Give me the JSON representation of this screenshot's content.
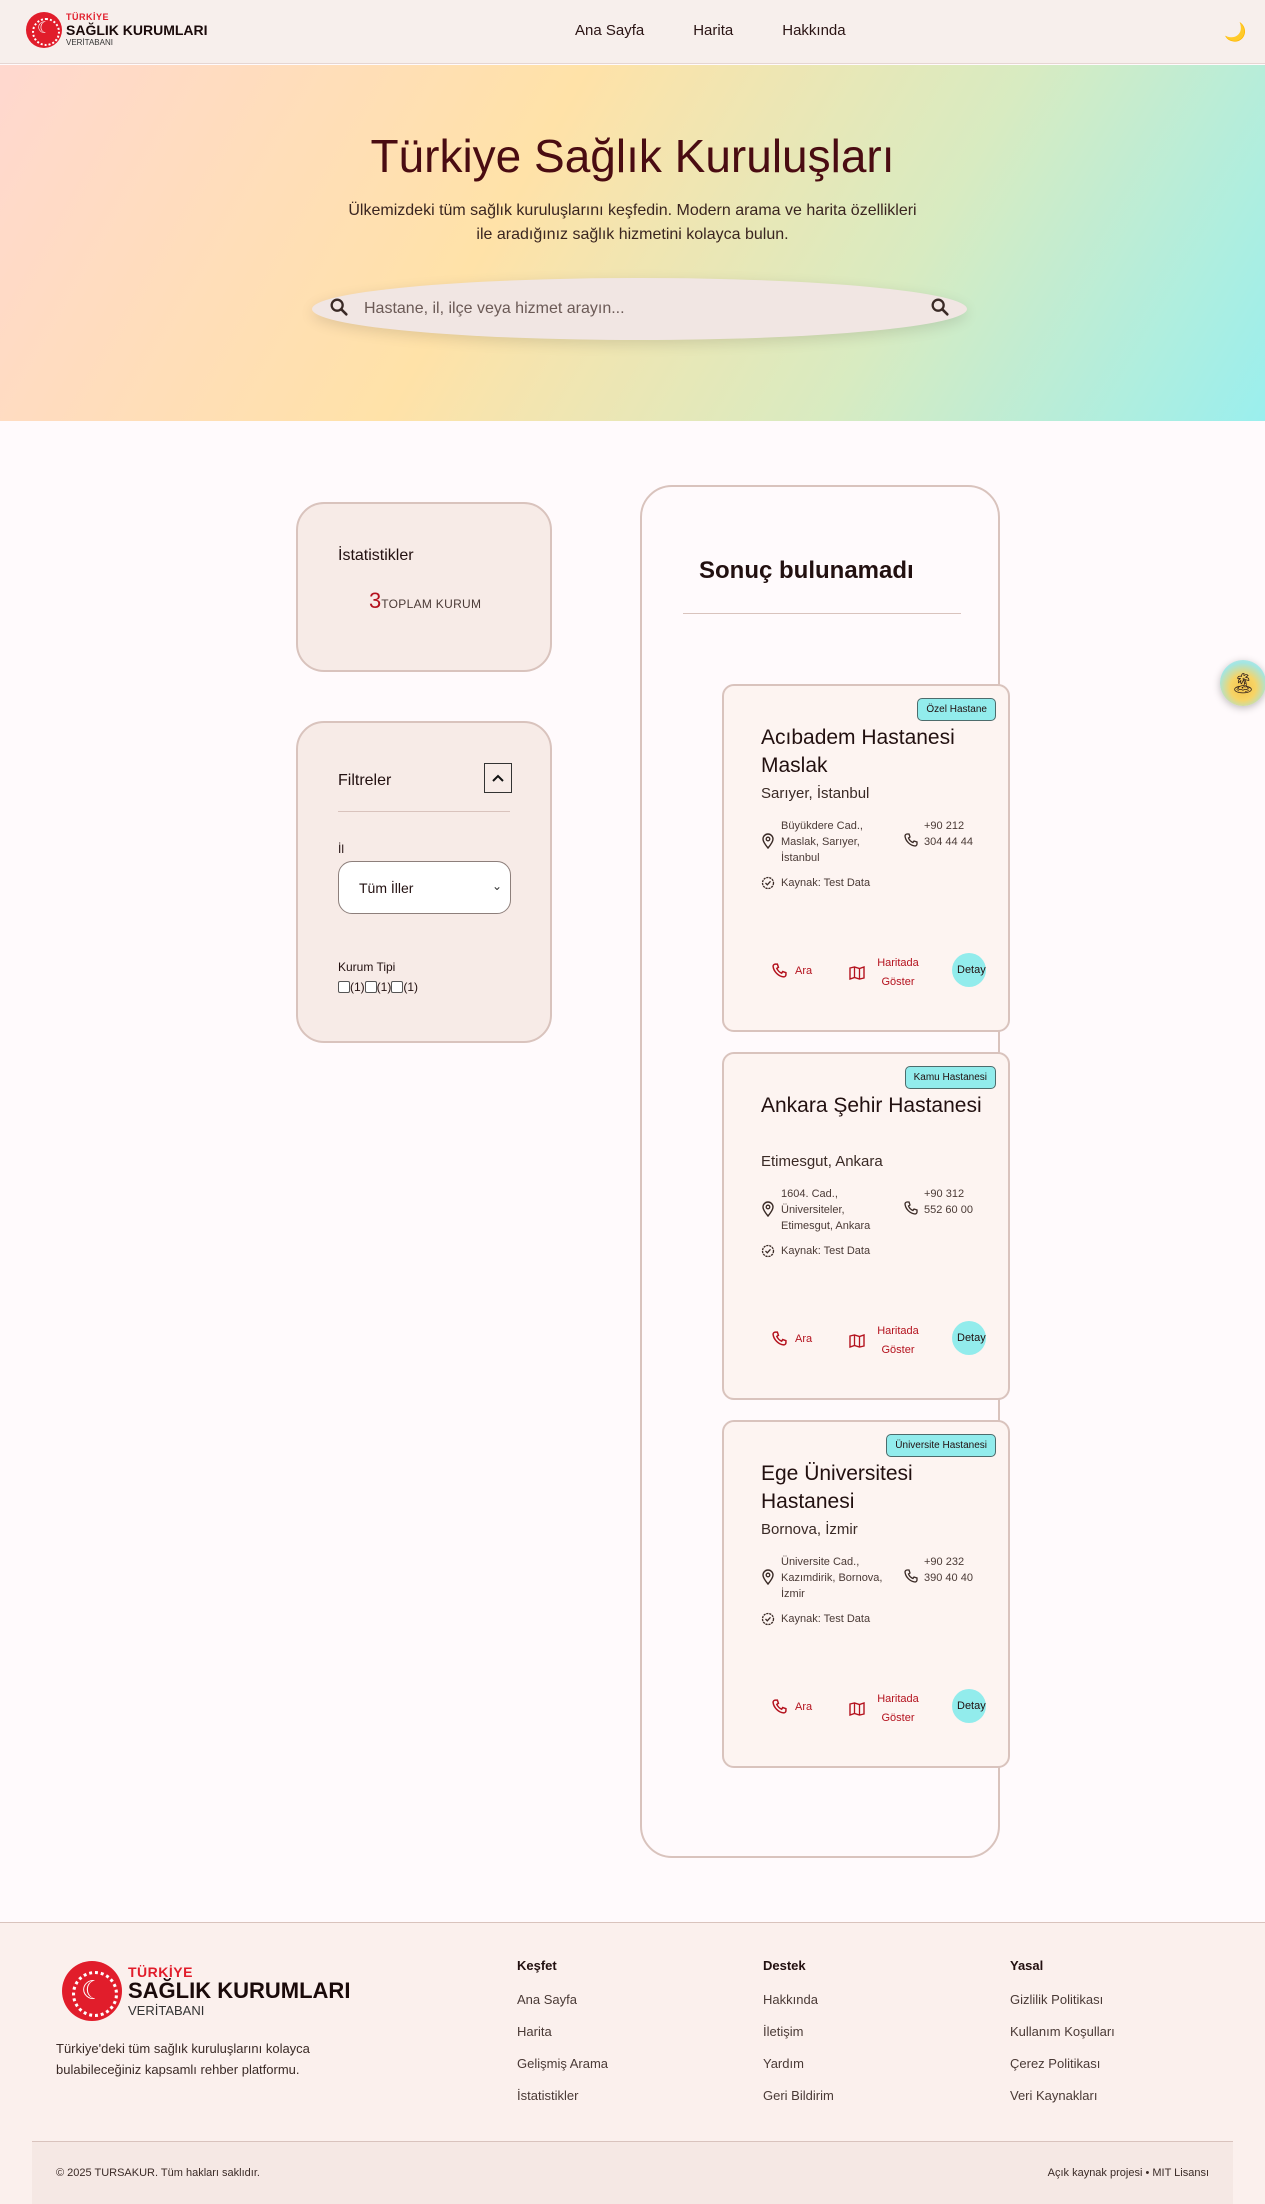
{
  "header": {
    "logo": {
      "line1": "TÜRKİYE",
      "line2": "SAĞLIK KURUMLARI",
      "line3": "VERİTABANI"
    },
    "nav": [
      "Ana Sayfa",
      "Harita",
      "Hakkında"
    ],
    "theme_icon": "moon-icon"
  },
  "hero": {
    "title": "Türkiye Sağlık Kuruluşları",
    "subtitle": "Ülkemizdeki tüm sağlık kuruluşlarını keşfedin. Modern arama ve harita özellikleri ile aradığınız sağlık hizmetini kolayca bulun.",
    "search_placeholder": "Hastane, il, ilçe veya hizmet arayın..."
  },
  "stats": {
    "title": "İstatistikler",
    "total": "3",
    "total_label": "TOPLAM KURUM"
  },
  "filters": {
    "title": "Filtreler",
    "il_label": "İl",
    "il_value": "Tüm İller",
    "kurum_tipi_label": "Kurum Tipi",
    "kurum_tipi_counts": [
      "(1)",
      "(1)",
      "(1)"
    ]
  },
  "results": {
    "title": "Sonuç bulunamadı",
    "cards": [
      {
        "badge": "Özel Hastane",
        "name": "Acıbadem Hastanesi Maslak",
        "location": "Sarıyer, İstanbul",
        "address": "Büyükdere Cad., Maslak, Sarıyer, İstanbul",
        "phone": "+90 212 304 44 44",
        "source": "Kaynak: Test Data",
        "call": "Ara",
        "map": "Haritada Göster",
        "detail": "Detay"
      },
      {
        "badge": "Kamu Hastanesi",
        "name": "Ankara Şehir Hastanesi",
        "location": "Etimesgut, Ankara",
        "address": "1604. Cad., Üniversiteler, Etimesgut, Ankara",
        "phone": "+90 312 552 60 00",
        "source": "Kaynak: Test Data",
        "call": "Ara",
        "map": "Haritada Göster",
        "detail": "Detay"
      },
      {
        "badge": "Üniversite Hastanesi",
        "name": "Ege Üniversitesi Hastanesi",
        "location": "Bornova, İzmir",
        "address": "Üniversite Cad., Kazımdirik, Bornova, İzmir",
        "phone": "+90 232 390 40 40",
        "source": "Kaynak: Test Data",
        "call": "Ara",
        "map": "Haritada Göster",
        "detail": "Detay"
      }
    ]
  },
  "footer": {
    "logo": {
      "line1": "TÜRKİYE",
      "line2": "SAĞLIK KURUMLARI",
      "line3": "VERİTABANI"
    },
    "description": "Türkiye'deki tüm sağlık kuruluşlarını kolayca bulabileceğiniz kapsamlı rehber platformu.",
    "columns": [
      {
        "title": "Keşfet",
        "links": [
          "Ana Sayfa",
          "Harita",
          "Gelişmiş Arama",
          "İstatistikler"
        ]
      },
      {
        "title": "Destek",
        "links": [
          "Hakkında",
          "İletişim",
          "Yardım",
          "Geri Bildirim"
        ]
      },
      {
        "title": "Yasal",
        "links": [
          "Gizlilik Politikası",
          "Kullanım Koşulları",
          "Çerez Politikası",
          "Veri Kaynakları"
        ]
      }
    ],
    "copyright": "© 2025 TURSAKUR. Tüm hakları saklıdır.",
    "license": "Açık kaynak projesi • MIT Lisansı"
  },
  "colors": {
    "accent": "#b4121e",
    "badge": "#92ecec",
    "brand_red": "#e11d2b"
  }
}
